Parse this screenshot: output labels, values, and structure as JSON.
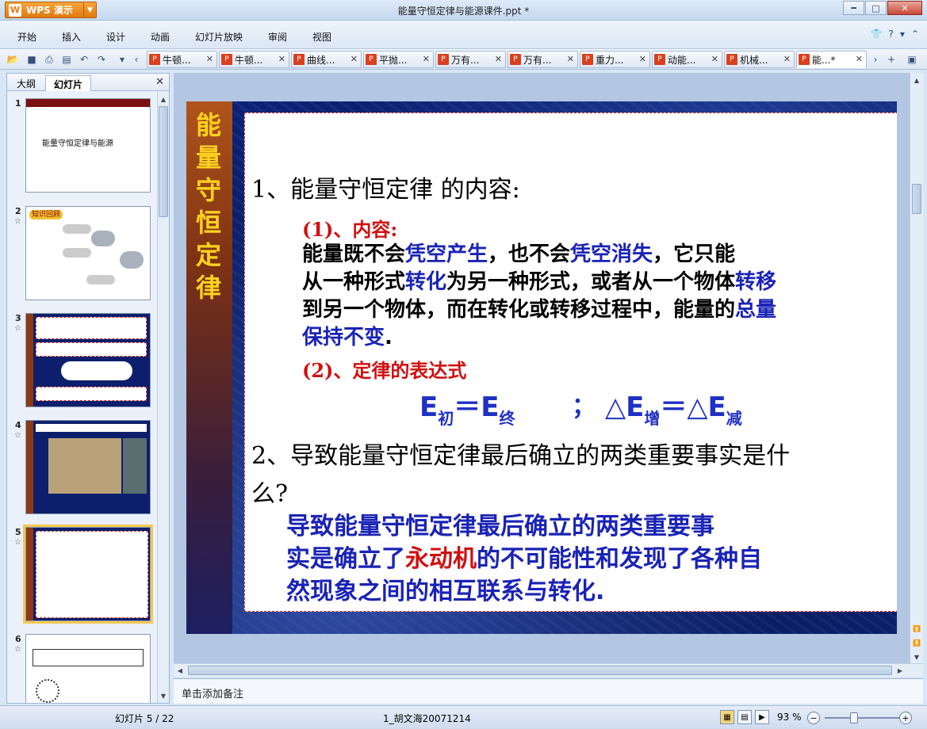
{
  "app": {
    "brand": "WPS 演示",
    "window_title": "能量守恒定律与能源课件.ppt *"
  },
  "menu": [
    "开始",
    "插入",
    "设计",
    "动画",
    "幻灯片放映",
    "审阅",
    "视图"
  ],
  "doc_tabs": [
    "牛顿...",
    "牛顿...",
    "曲线...",
    "平抛...",
    "万有...",
    "万有...",
    "重力...",
    "动能...",
    "机械...",
    "能...*"
  ],
  "left_pane": {
    "tabs": [
      "大纲",
      "幻灯片"
    ],
    "thumbnails": [
      {
        "num": "1",
        "title": "能量守恒定律与能源"
      },
      {
        "num": "2",
        "title": "知识回顾"
      },
      {
        "num": "3",
        "title": ""
      },
      {
        "num": "4",
        "title": ""
      },
      {
        "num": "5",
        "title": ""
      },
      {
        "num": "6",
        "title": ""
      }
    ]
  },
  "slide": {
    "banner_text": [
      "能",
      "量",
      "守",
      "恒",
      "定",
      "律"
    ],
    "q1": "1、能量守恒定律 的内容:",
    "h1": "(1)、内容:",
    "para": [
      [
        {
          "t": "        能量既不会",
          "h": false
        },
        {
          "t": "凭空产生",
          "h": true
        },
        {
          "t": "，也不会",
          "h": false
        },
        {
          "t": "凭空消失",
          "h": true
        },
        {
          "t": "，它只能",
          "h": false
        }
      ],
      [
        {
          "t": "从一种形式",
          "h": false
        },
        {
          "t": "转化",
          "h": true
        },
        {
          "t": "为另一种形式，或者从一个物体",
          "h": false
        },
        {
          "t": "转移",
          "h": true
        }
      ],
      [
        {
          "t": "到另一个物体，而在转化或转移过程中，能量的",
          "h": false
        },
        {
          "t": "总量",
          "h": true
        }
      ],
      [
        {
          "t": "保持不变",
          "h": true
        },
        {
          "t": ".",
          "h": false
        }
      ]
    ],
    "h2": "(2)、定律的表达式",
    "formula": {
      "e": "E",
      "s1": "初",
      "eq": "＝",
      "s2": "终",
      "sep": "；",
      "delta": "△",
      "s3": "增",
      "s4": "减"
    },
    "q2_line1": "2、导致能量守恒定律最后确立的两类重要事实是什",
    "q2_line2": "么?",
    "answer_line1": "        导致能量守恒定律最后确立的两类重要事",
    "answer_line2_a": "实是确立了",
    "answer_line2_red": "永动机",
    "answer_line2_b": "的不可能性和发现了各种自",
    "answer_line3": "然现象之间的相互联系与转化."
  },
  "notes_placeholder": "单击添加备注",
  "status": {
    "slide_info": "幻灯片 5 / 22",
    "template": "1_胡文海20071214",
    "zoom": "93 %"
  },
  "colors": {
    "accent_orange": "#e07a10",
    "slide_bg": "#0a1a55",
    "banner_text": "#ffd21f",
    "highlight_blue": "#1a23b5",
    "highlight_red": "#d01010"
  }
}
